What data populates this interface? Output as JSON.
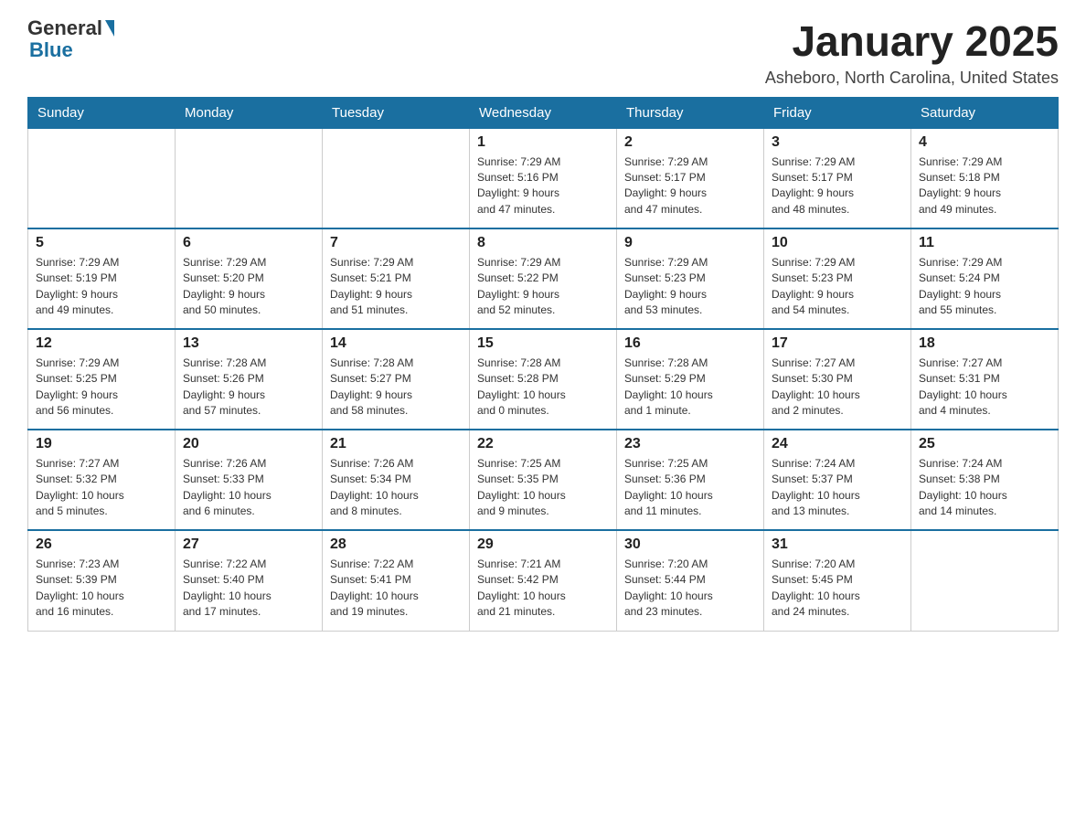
{
  "logo": {
    "general": "General",
    "blue": "Blue"
  },
  "header": {
    "month": "January 2025",
    "location": "Asheboro, North Carolina, United States"
  },
  "weekdays": [
    "Sunday",
    "Monday",
    "Tuesday",
    "Wednesday",
    "Thursday",
    "Friday",
    "Saturday"
  ],
  "weeks": [
    [
      {
        "day": "",
        "info": ""
      },
      {
        "day": "",
        "info": ""
      },
      {
        "day": "",
        "info": ""
      },
      {
        "day": "1",
        "info": "Sunrise: 7:29 AM\nSunset: 5:16 PM\nDaylight: 9 hours\nand 47 minutes."
      },
      {
        "day": "2",
        "info": "Sunrise: 7:29 AM\nSunset: 5:17 PM\nDaylight: 9 hours\nand 47 minutes."
      },
      {
        "day": "3",
        "info": "Sunrise: 7:29 AM\nSunset: 5:17 PM\nDaylight: 9 hours\nand 48 minutes."
      },
      {
        "day": "4",
        "info": "Sunrise: 7:29 AM\nSunset: 5:18 PM\nDaylight: 9 hours\nand 49 minutes."
      }
    ],
    [
      {
        "day": "5",
        "info": "Sunrise: 7:29 AM\nSunset: 5:19 PM\nDaylight: 9 hours\nand 49 minutes."
      },
      {
        "day": "6",
        "info": "Sunrise: 7:29 AM\nSunset: 5:20 PM\nDaylight: 9 hours\nand 50 minutes."
      },
      {
        "day": "7",
        "info": "Sunrise: 7:29 AM\nSunset: 5:21 PM\nDaylight: 9 hours\nand 51 minutes."
      },
      {
        "day": "8",
        "info": "Sunrise: 7:29 AM\nSunset: 5:22 PM\nDaylight: 9 hours\nand 52 minutes."
      },
      {
        "day": "9",
        "info": "Sunrise: 7:29 AM\nSunset: 5:23 PM\nDaylight: 9 hours\nand 53 minutes."
      },
      {
        "day": "10",
        "info": "Sunrise: 7:29 AM\nSunset: 5:23 PM\nDaylight: 9 hours\nand 54 minutes."
      },
      {
        "day": "11",
        "info": "Sunrise: 7:29 AM\nSunset: 5:24 PM\nDaylight: 9 hours\nand 55 minutes."
      }
    ],
    [
      {
        "day": "12",
        "info": "Sunrise: 7:29 AM\nSunset: 5:25 PM\nDaylight: 9 hours\nand 56 minutes."
      },
      {
        "day": "13",
        "info": "Sunrise: 7:28 AM\nSunset: 5:26 PM\nDaylight: 9 hours\nand 57 minutes."
      },
      {
        "day": "14",
        "info": "Sunrise: 7:28 AM\nSunset: 5:27 PM\nDaylight: 9 hours\nand 58 minutes."
      },
      {
        "day": "15",
        "info": "Sunrise: 7:28 AM\nSunset: 5:28 PM\nDaylight: 10 hours\nand 0 minutes."
      },
      {
        "day": "16",
        "info": "Sunrise: 7:28 AM\nSunset: 5:29 PM\nDaylight: 10 hours\nand 1 minute."
      },
      {
        "day": "17",
        "info": "Sunrise: 7:27 AM\nSunset: 5:30 PM\nDaylight: 10 hours\nand 2 minutes."
      },
      {
        "day": "18",
        "info": "Sunrise: 7:27 AM\nSunset: 5:31 PM\nDaylight: 10 hours\nand 4 minutes."
      }
    ],
    [
      {
        "day": "19",
        "info": "Sunrise: 7:27 AM\nSunset: 5:32 PM\nDaylight: 10 hours\nand 5 minutes."
      },
      {
        "day": "20",
        "info": "Sunrise: 7:26 AM\nSunset: 5:33 PM\nDaylight: 10 hours\nand 6 minutes."
      },
      {
        "day": "21",
        "info": "Sunrise: 7:26 AM\nSunset: 5:34 PM\nDaylight: 10 hours\nand 8 minutes."
      },
      {
        "day": "22",
        "info": "Sunrise: 7:25 AM\nSunset: 5:35 PM\nDaylight: 10 hours\nand 9 minutes."
      },
      {
        "day": "23",
        "info": "Sunrise: 7:25 AM\nSunset: 5:36 PM\nDaylight: 10 hours\nand 11 minutes."
      },
      {
        "day": "24",
        "info": "Sunrise: 7:24 AM\nSunset: 5:37 PM\nDaylight: 10 hours\nand 13 minutes."
      },
      {
        "day": "25",
        "info": "Sunrise: 7:24 AM\nSunset: 5:38 PM\nDaylight: 10 hours\nand 14 minutes."
      }
    ],
    [
      {
        "day": "26",
        "info": "Sunrise: 7:23 AM\nSunset: 5:39 PM\nDaylight: 10 hours\nand 16 minutes."
      },
      {
        "day": "27",
        "info": "Sunrise: 7:22 AM\nSunset: 5:40 PM\nDaylight: 10 hours\nand 17 minutes."
      },
      {
        "day": "28",
        "info": "Sunrise: 7:22 AM\nSunset: 5:41 PM\nDaylight: 10 hours\nand 19 minutes."
      },
      {
        "day": "29",
        "info": "Sunrise: 7:21 AM\nSunset: 5:42 PM\nDaylight: 10 hours\nand 21 minutes."
      },
      {
        "day": "30",
        "info": "Sunrise: 7:20 AM\nSunset: 5:44 PM\nDaylight: 10 hours\nand 23 minutes."
      },
      {
        "day": "31",
        "info": "Sunrise: 7:20 AM\nSunset: 5:45 PM\nDaylight: 10 hours\nand 24 minutes."
      },
      {
        "day": "",
        "info": ""
      }
    ]
  ]
}
